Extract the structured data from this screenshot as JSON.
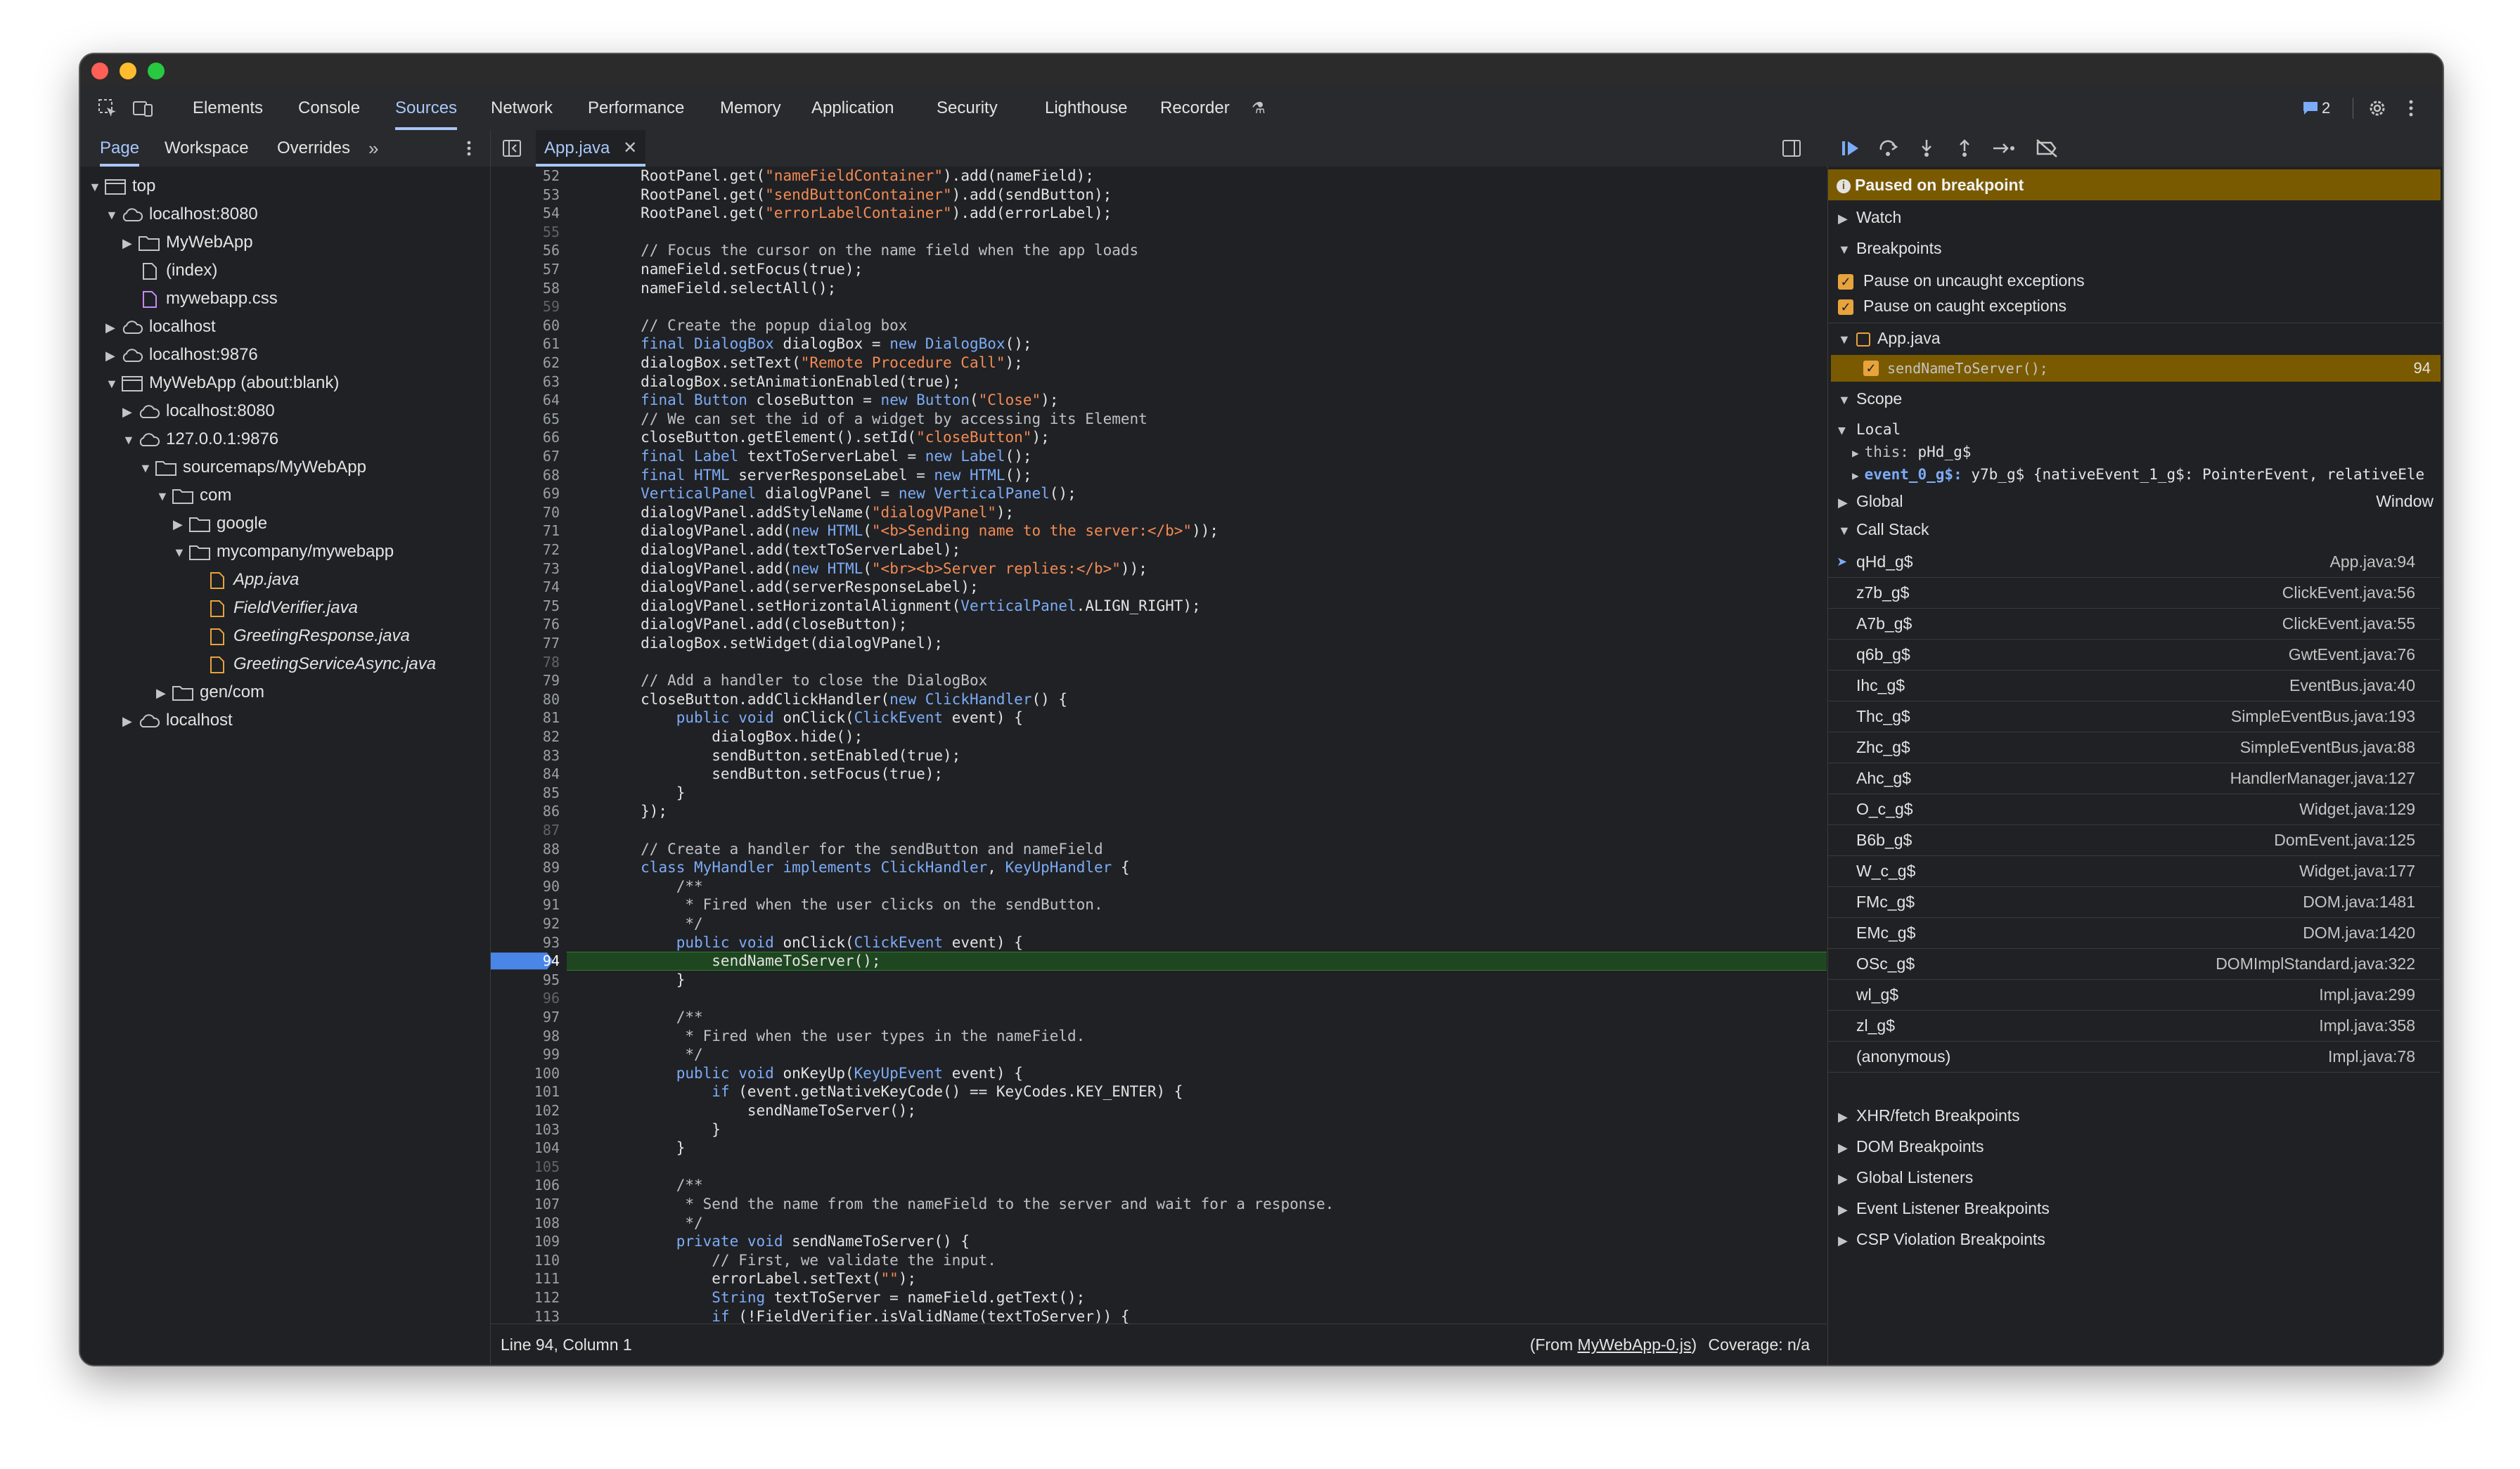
{
  "tabs": [
    "Elements",
    "Console",
    "Sources",
    "Network",
    "Performance",
    "Memory",
    "Application",
    "Security",
    "Lighthouse",
    "Recorder"
  ],
  "issues_count": "2",
  "subtabs": [
    "Page",
    "Workspace",
    "Overrides"
  ],
  "file_tab": "App.java",
  "tree": [
    {
      "label": "top",
      "depth": 0,
      "arrow": "▼",
      "icon": "frame-icon"
    },
    {
      "label": "localhost:8080",
      "depth": 1,
      "arrow": "▼",
      "icon": "cloud-icon"
    },
    {
      "label": "MyWebApp",
      "depth": 2,
      "arrow": "▶",
      "icon": "folder-icon"
    },
    {
      "label": "(index)",
      "depth": 2,
      "arrow": "",
      "icon": "file-icon"
    },
    {
      "label": "mywebapp.css",
      "depth": 2,
      "arrow": "",
      "icon": "css-file-icon"
    },
    {
      "label": "localhost",
      "depth": 1,
      "arrow": "▶",
      "icon": "cloud-icon"
    },
    {
      "label": "localhost:9876",
      "depth": 1,
      "arrow": "▶",
      "icon": "cloud-icon"
    },
    {
      "label": "MyWebApp (about:blank)",
      "depth": 1,
      "arrow": "▼",
      "icon": "frame-icon"
    },
    {
      "label": "localhost:8080",
      "depth": 2,
      "arrow": "▶",
      "icon": "cloud-icon"
    },
    {
      "label": "127.0.0.1:9876",
      "depth": 2,
      "arrow": "▼",
      "icon": "cloud-icon"
    },
    {
      "label": "sourcemaps/MyWebApp",
      "depth": 3,
      "arrow": "▼",
      "icon": "folder-icon"
    },
    {
      "label": "com",
      "depth": 4,
      "arrow": "▼",
      "icon": "folder-icon"
    },
    {
      "label": "google",
      "depth": 5,
      "arrow": "▶",
      "icon": "folder-icon"
    },
    {
      "label": "mycompany/mywebapp",
      "depth": 5,
      "arrow": "▼",
      "icon": "folder-icon"
    },
    {
      "label": "App.java",
      "depth": 6,
      "arrow": "",
      "icon": "java-file-icon",
      "italic": true
    },
    {
      "label": "FieldVerifier.java",
      "depth": 6,
      "arrow": "",
      "icon": "java-file-icon",
      "italic": true
    },
    {
      "label": "GreetingResponse.java",
      "depth": 6,
      "arrow": "",
      "icon": "java-file-icon",
      "italic": true
    },
    {
      "label": "GreetingServiceAsync.java",
      "depth": 6,
      "arrow": "",
      "icon": "java-file-icon",
      "italic": true
    },
    {
      "label": "gen/com",
      "depth": 4,
      "arrow": "▶",
      "icon": "folder-icon"
    },
    {
      "label": "localhost",
      "depth": 2,
      "arrow": "▶",
      "icon": "cloud-icon"
    }
  ],
  "code_lines": [
    {
      "n": "52",
      "text": "        RootPanel.get(\"nameFieldContainer\").add(nameField);"
    },
    {
      "n": "53",
      "text": "        RootPanel.get(\"sendButtonContainer\").add(sendButton);"
    },
    {
      "n": "54",
      "text": "        RootPanel.get(\"errorLabelContainer\").add(errorLabel);"
    },
    {
      "n": "55",
      "text": ""
    },
    {
      "n": "56",
      "text": "        // Focus the cursor on the name field when the app loads"
    },
    {
      "n": "57",
      "text": "        nameField.setFocus(true);"
    },
    {
      "n": "58",
      "text": "        nameField.selectAll();"
    },
    {
      "n": "59",
      "text": ""
    },
    {
      "n": "60",
      "text": "        // Create the popup dialog box"
    },
    {
      "n": "61",
      "text": "        final DialogBox dialogBox = new DialogBox();"
    },
    {
      "n": "62",
      "text": "        dialogBox.setText(\"Remote Procedure Call\");"
    },
    {
      "n": "63",
      "text": "        dialogBox.setAnimationEnabled(true);"
    },
    {
      "n": "64",
      "text": "        final Button closeButton = new Button(\"Close\");"
    },
    {
      "n": "65",
      "text": "        // We can set the id of a widget by accessing its Element"
    },
    {
      "n": "66",
      "text": "        closeButton.getElement().setId(\"closeButton\");"
    },
    {
      "n": "67",
      "text": "        final Label textToServerLabel = new Label();"
    },
    {
      "n": "68",
      "text": "        final HTML serverResponseLabel = new HTML();"
    },
    {
      "n": "69",
      "text": "        VerticalPanel dialogVPanel = new VerticalPanel();"
    },
    {
      "n": "70",
      "text": "        dialogVPanel.addStyleName(\"dialogVPanel\");"
    },
    {
      "n": "71",
      "text": "        dialogVPanel.add(new HTML(\"<b>Sending name to the server:</b>\"));"
    },
    {
      "n": "72",
      "text": "        dialogVPanel.add(textToServerLabel);"
    },
    {
      "n": "73",
      "text": "        dialogVPanel.add(new HTML(\"<br><b>Server replies:</b>\"));"
    },
    {
      "n": "74",
      "text": "        dialogVPanel.add(serverResponseLabel);"
    },
    {
      "n": "75",
      "text": "        dialogVPanel.setHorizontalAlignment(VerticalPanel.ALIGN_RIGHT);"
    },
    {
      "n": "76",
      "text": "        dialogVPanel.add(closeButton);"
    },
    {
      "n": "77",
      "text": "        dialogBox.setWidget(dialogVPanel);"
    },
    {
      "n": "78",
      "text": ""
    },
    {
      "n": "79",
      "text": "        // Add a handler to close the DialogBox"
    },
    {
      "n": "80",
      "text": "        closeButton.addClickHandler(new ClickHandler() {"
    },
    {
      "n": "81",
      "text": "            public void onClick(ClickEvent event) {"
    },
    {
      "n": "82",
      "text": "                dialogBox.hide();"
    },
    {
      "n": "83",
      "text": "                sendButton.setEnabled(true);"
    },
    {
      "n": "84",
      "text": "                sendButton.setFocus(true);"
    },
    {
      "n": "85",
      "text": "            }"
    },
    {
      "n": "86",
      "text": "        });"
    },
    {
      "n": "87",
      "text": ""
    },
    {
      "n": "88",
      "text": "        // Create a handler for the sendButton and nameField"
    },
    {
      "n": "89",
      "text": "        class MyHandler implements ClickHandler, KeyUpHandler {"
    },
    {
      "n": "90",
      "text": "            /**"
    },
    {
      "n": "91",
      "text": "             * Fired when the user clicks on the sendButton."
    },
    {
      "n": "92",
      "text": "             */"
    },
    {
      "n": "93",
      "text": "            public void onClick(ClickEvent event) {"
    },
    {
      "n": "94",
      "text": "                sendNameToServer();"
    },
    {
      "n": "95",
      "text": "            }"
    },
    {
      "n": "96",
      "text": ""
    },
    {
      "n": "97",
      "text": "            /**"
    },
    {
      "n": "98",
      "text": "             * Fired when the user types in the nameField."
    },
    {
      "n": "99",
      "text": "             */"
    },
    {
      "n": "100",
      "text": "            public void onKeyUp(KeyUpEvent event) {"
    },
    {
      "n": "101",
      "text": "                if (event.getNativeKeyCode() == KeyCodes.KEY_ENTER) {"
    },
    {
      "n": "102",
      "text": "                    sendNameToServer();"
    },
    {
      "n": "103",
      "text": "                }"
    },
    {
      "n": "104",
      "text": "            }"
    },
    {
      "n": "105",
      "text": ""
    },
    {
      "n": "106",
      "text": "            /**"
    },
    {
      "n": "107",
      "text": "             * Send the name from the nameField to the server and wait for a response."
    },
    {
      "n": "108",
      "text": "             */"
    },
    {
      "n": "109",
      "text": "            private void sendNameToServer() {"
    },
    {
      "n": "110",
      "text": "                // First, we validate the input."
    },
    {
      "n": "111",
      "text": "                errorLabel.setText(\"\");"
    },
    {
      "n": "112",
      "text": "                String textToServer = nameField.getText();"
    },
    {
      "n": "113",
      "text": "                if (!FieldVerifier.isValidName(textToServer)) {"
    }
  ],
  "current_line": "94",
  "status": {
    "position": "Line 94, Column 1",
    "from_prefix": "(From ",
    "from_link": "MyWebApp-0.js",
    "from_suffix": ")",
    "coverage": "Coverage: n/a"
  },
  "debugger": {
    "paused": "Paused on breakpoint",
    "watch": "Watch",
    "breakpoints": "Breakpoints",
    "pause_uncaught": "Pause on uncaught exceptions",
    "pause_caught": "Pause on caught exceptions",
    "bp_file": "App.java",
    "bp_code": "sendNameToServer();",
    "bp_line": "94",
    "scope": "Scope",
    "local": "Local",
    "this_key": "this:",
    "this_val": "pHd_g$",
    "event_key": "event_0_g$:",
    "event_val": "y7b_g$ {nativeEvent_1_g$: PointerEvent, relativeEle",
    "global": "Global",
    "global_val": "Window",
    "call_stack": "Call Stack",
    "frames": [
      {
        "fn": "qHd_g$",
        "loc": "App.java:94"
      },
      {
        "fn": "z7b_g$",
        "loc": "ClickEvent.java:56"
      },
      {
        "fn": "A7b_g$",
        "loc": "ClickEvent.java:55"
      },
      {
        "fn": "q6b_g$",
        "loc": "GwtEvent.java:76"
      },
      {
        "fn": "Ihc_g$",
        "loc": "EventBus.java:40"
      },
      {
        "fn": "Thc_g$",
        "loc": "SimpleEventBus.java:193"
      },
      {
        "fn": "Zhc_g$",
        "loc": "SimpleEventBus.java:88"
      },
      {
        "fn": "Ahc_g$",
        "loc": "HandlerManager.java:127"
      },
      {
        "fn": "O_c_g$",
        "loc": "Widget.java:129"
      },
      {
        "fn": "B6b_g$",
        "loc": "DomEvent.java:125"
      },
      {
        "fn": "W_c_g$",
        "loc": "Widget.java:177"
      },
      {
        "fn": "FMc_g$",
        "loc": "DOM.java:1481"
      },
      {
        "fn": "EMc_g$",
        "loc": "DOM.java:1420"
      },
      {
        "fn": "OSc_g$",
        "loc": "DOMImplStandard.java:322"
      },
      {
        "fn": "wl_g$",
        "loc": "Impl.java:299"
      },
      {
        "fn": "zl_g$",
        "loc": "Impl.java:358"
      },
      {
        "fn": "(anonymous)",
        "loc": "Impl.java:78"
      }
    ],
    "collapsed_sections": [
      "XHR/fetch Breakpoints",
      "DOM Breakpoints",
      "Global Listeners",
      "Event Listener Breakpoints",
      "CSP Violation Breakpoints"
    ]
  },
  "colors": {
    "accent": "#a8c7fa",
    "paused_banner": "#7a5a00",
    "exec_line": "#1e4620",
    "breakpoint": "#4a86e8",
    "checkbox": "#e8a33d"
  }
}
